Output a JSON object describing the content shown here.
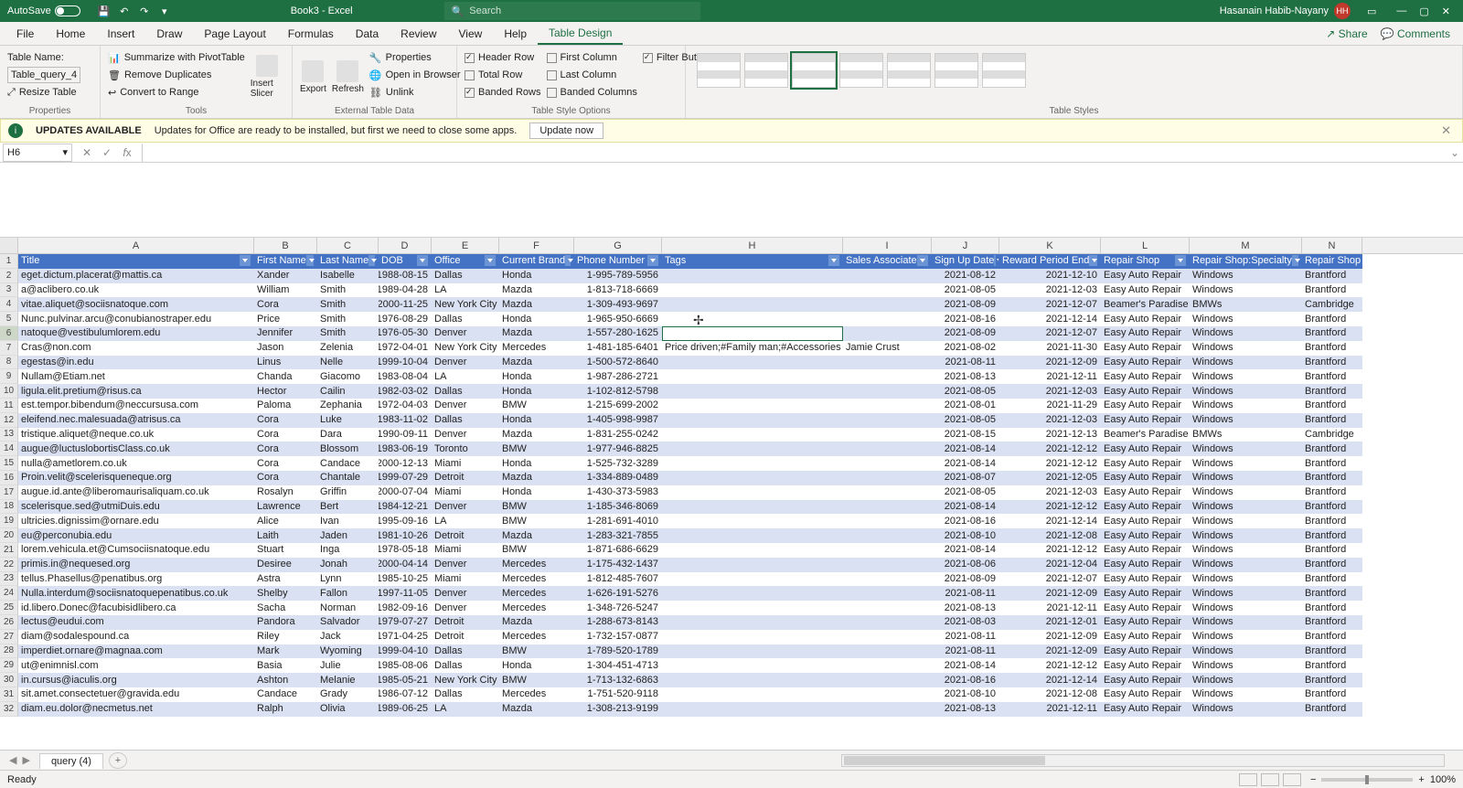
{
  "titlebar": {
    "autosave": "AutoSave",
    "autosave_state": "Off",
    "doc": "Book3 - Excel",
    "search_placeholder": "Search",
    "user": "Hasanain Habib-Nayany",
    "initials": "HH"
  },
  "tabs": [
    "File",
    "Home",
    "Insert",
    "Draw",
    "Page Layout",
    "Formulas",
    "Data",
    "Review",
    "View",
    "Help",
    "Table Design"
  ],
  "active_tab": "Table Design",
  "ribbon_right": {
    "share": "Share",
    "comments": "Comments"
  },
  "ribbon": {
    "properties": {
      "label": "Properties",
      "name_lbl": "Table Name:",
      "name_val": "Table_query_4",
      "resize": "Resize Table"
    },
    "tools": {
      "label": "Tools",
      "pivot": "Summarize with PivotTable",
      "dup": "Remove Duplicates",
      "range": "Convert to Range",
      "slicer": "Insert\nSlicer"
    },
    "external": {
      "label": "External Table Data",
      "export": "Export",
      "refresh": "Refresh",
      "props": "Properties",
      "browser": "Open in Browser",
      "unlink": "Unlink"
    },
    "styleopts": {
      "label": "Table Style Options",
      "header_row": "Header Row",
      "total_row": "Total Row",
      "banded_rows": "Banded Rows",
      "first_col": "First Column",
      "last_col": "Last Column",
      "banded_cols": "Banded Columns",
      "filter": "Filter Button"
    },
    "styles": {
      "label": "Table Styles"
    }
  },
  "msgbar": {
    "title": "UPDATES AVAILABLE",
    "text": "Updates for Office are ready to be installed, but first we need to close some apps.",
    "btn": "Update now"
  },
  "namebox": "H6",
  "columns": [
    {
      "letter": "A",
      "cls": "col-A",
      "field": "Title"
    },
    {
      "letter": "B",
      "cls": "col-B",
      "field": "First Name"
    },
    {
      "letter": "C",
      "cls": "col-C",
      "field": "Last Name"
    },
    {
      "letter": "D",
      "cls": "col-D",
      "field": "DOB"
    },
    {
      "letter": "E",
      "cls": "col-E",
      "field": "Office"
    },
    {
      "letter": "F",
      "cls": "col-F",
      "field": "Current Brand"
    },
    {
      "letter": "G",
      "cls": "col-G",
      "field": "Phone Number"
    },
    {
      "letter": "H",
      "cls": "col-H",
      "field": "Tags"
    },
    {
      "letter": "I",
      "cls": "col-I",
      "field": "Sales Associate"
    },
    {
      "letter": "J",
      "cls": "col-J",
      "field": "Sign Up Date"
    },
    {
      "letter": "K",
      "cls": "col-K",
      "field": "Reward Period End"
    },
    {
      "letter": "L",
      "cls": "col-L",
      "field": "Repair Shop"
    },
    {
      "letter": "M",
      "cls": "col-M",
      "field": "Repair Shop:Specialty"
    },
    {
      "letter": "N",
      "cls": "col-N",
      "field": "Repair Shop"
    }
  ],
  "right_align": [
    "DOB",
    "Phone Number",
    "Sign Up Date",
    "Reward Period End"
  ],
  "selected_row": 6,
  "rows": [
    {
      "n": 2,
      "d": [
        "eget.dictum.placerat@mattis.ca",
        "Xander",
        "Isabelle",
        "1988-08-15",
        "Dallas",
        "Honda",
        "1-995-789-5956",
        "",
        "",
        "2021-08-12",
        "2021-12-10",
        "Easy Auto Repair",
        "Windows",
        "Brantford"
      ]
    },
    {
      "n": 3,
      "d": [
        "a@aclibero.co.uk",
        "William",
        "Smith",
        "1989-04-28",
        "LA",
        "Mazda",
        "1-813-718-6669",
        "",
        "",
        "2021-08-05",
        "2021-12-03",
        "Easy Auto Repair",
        "Windows",
        "Brantford"
      ]
    },
    {
      "n": 4,
      "d": [
        "vitae.aliquet@sociisnatoque.com",
        "Cora",
        "Smith",
        "2000-11-25",
        "New York City",
        "Mazda",
        "1-309-493-9697",
        "",
        "",
        "2021-08-09",
        "2021-12-07",
        "Beamer's Paradise",
        "BMWs",
        "Cambridge"
      ]
    },
    {
      "n": 5,
      "d": [
        "Nunc.pulvinar.arcu@conubianostraper.edu",
        "Price",
        "Smith",
        "1976-08-29",
        "Dallas",
        "Honda",
        "1-965-950-6669",
        "",
        "",
        "2021-08-16",
        "2021-12-14",
        "Easy Auto Repair",
        "Windows",
        "Brantford"
      ]
    },
    {
      "n": 6,
      "d": [
        "natoque@vestibulumlorem.edu",
        "Jennifer",
        "Smith",
        "1976-05-30",
        "Denver",
        "Mazda",
        "1-557-280-1625",
        "",
        "",
        "2021-08-09",
        "2021-12-07",
        "Easy Auto Repair",
        "Windows",
        "Brantford"
      ]
    },
    {
      "n": 7,
      "d": [
        "Cras@non.com",
        "Jason",
        "Zelenia",
        "1972-04-01",
        "New York City",
        "Mercedes",
        "1-481-185-6401",
        "Price driven;#Family man;#Accessories",
        "Jamie Crust",
        "2021-08-02",
        "2021-11-30",
        "Easy Auto Repair",
        "Windows",
        "Brantford"
      ]
    },
    {
      "n": 8,
      "d": [
        "egestas@in.edu",
        "Linus",
        "Nelle",
        "1999-10-04",
        "Denver",
        "Mazda",
        "1-500-572-8640",
        "",
        "",
        "2021-08-11",
        "2021-12-09",
        "Easy Auto Repair",
        "Windows",
        "Brantford"
      ]
    },
    {
      "n": 9,
      "d": [
        "Nullam@Etiam.net",
        "Chanda",
        "Giacomo",
        "1983-08-04",
        "LA",
        "Honda",
        "1-987-286-2721",
        "",
        "",
        "2021-08-13",
        "2021-12-11",
        "Easy Auto Repair",
        "Windows",
        "Brantford"
      ]
    },
    {
      "n": 10,
      "d": [
        "ligula.elit.pretium@risus.ca",
        "Hector",
        "Cailin",
        "1982-03-02",
        "Dallas",
        "Honda",
        "1-102-812-5798",
        "",
        "",
        "2021-08-05",
        "2021-12-03",
        "Easy Auto Repair",
        "Windows",
        "Brantford"
      ]
    },
    {
      "n": 11,
      "d": [
        "est.tempor.bibendum@neccursusa.com",
        "Paloma",
        "Zephania",
        "1972-04-03",
        "Denver",
        "BMW",
        "1-215-699-2002",
        "",
        "",
        "2021-08-01",
        "2021-11-29",
        "Easy Auto Repair",
        "Windows",
        "Brantford"
      ]
    },
    {
      "n": 12,
      "d": [
        "eleifend.nec.malesuada@atrisus.ca",
        "Cora",
        "Luke",
        "1983-11-02",
        "Dallas",
        "Honda",
        "1-405-998-9987",
        "",
        "",
        "2021-08-05",
        "2021-12-03",
        "Easy Auto Repair",
        "Windows",
        "Brantford"
      ]
    },
    {
      "n": 13,
      "d": [
        "tristique.aliquet@neque.co.uk",
        "Cora",
        "Dara",
        "1990-09-11",
        "Denver",
        "Mazda",
        "1-831-255-0242",
        "",
        "",
        "2021-08-15",
        "2021-12-13",
        "Beamer's Paradise",
        "BMWs",
        "Cambridge"
      ]
    },
    {
      "n": 14,
      "d": [
        "augue@luctuslobortisClass.co.uk",
        "Cora",
        "Blossom",
        "1983-06-19",
        "Toronto",
        "BMW",
        "1-977-946-8825",
        "",
        "",
        "2021-08-14",
        "2021-12-12",
        "Easy Auto Repair",
        "Windows",
        "Brantford"
      ]
    },
    {
      "n": 15,
      "d": [
        "nulla@ametlorem.co.uk",
        "Cora",
        "Candace",
        "2000-12-13",
        "Miami",
        "Honda",
        "1-525-732-3289",
        "",
        "",
        "2021-08-14",
        "2021-12-12",
        "Easy Auto Repair",
        "Windows",
        "Brantford"
      ]
    },
    {
      "n": 16,
      "d": [
        "Proin.velit@scelerisqueneque.org",
        "Cora",
        "Chantale",
        "1999-07-29",
        "Detroit",
        "Mazda",
        "1-334-889-0489",
        "",
        "",
        "2021-08-07",
        "2021-12-05",
        "Easy Auto Repair",
        "Windows",
        "Brantford"
      ]
    },
    {
      "n": 17,
      "d": [
        "augue.id.ante@liberomaurisaliquam.co.uk",
        "Rosalyn",
        "Griffin",
        "2000-07-04",
        "Miami",
        "Honda",
        "1-430-373-5983",
        "",
        "",
        "2021-08-05",
        "2021-12-03",
        "Easy Auto Repair",
        "Windows",
        "Brantford"
      ]
    },
    {
      "n": 18,
      "d": [
        "scelerisque.sed@utmiDuis.edu",
        "Lawrence",
        "Bert",
        "1984-12-21",
        "Denver",
        "BMW",
        "1-185-346-8069",
        "",
        "",
        "2021-08-14",
        "2021-12-12",
        "Easy Auto Repair",
        "Windows",
        "Brantford"
      ]
    },
    {
      "n": 19,
      "d": [
        "ultricies.dignissim@ornare.edu",
        "Alice",
        "Ivan",
        "1995-09-16",
        "LA",
        "BMW",
        "1-281-691-4010",
        "",
        "",
        "2021-08-16",
        "2021-12-14",
        "Easy Auto Repair",
        "Windows",
        "Brantford"
      ]
    },
    {
      "n": 20,
      "d": [
        "eu@perconubia.edu",
        "Laith",
        "Jaden",
        "1981-10-26",
        "Detroit",
        "Mazda",
        "1-283-321-7855",
        "",
        "",
        "2021-08-10",
        "2021-12-08",
        "Easy Auto Repair",
        "Windows",
        "Brantford"
      ]
    },
    {
      "n": 21,
      "d": [
        "lorem.vehicula.et@Cumsociisnatoque.edu",
        "Stuart",
        "Inga",
        "1978-05-18",
        "Miami",
        "BMW",
        "1-871-686-6629",
        "",
        "",
        "2021-08-14",
        "2021-12-12",
        "Easy Auto Repair",
        "Windows",
        "Brantford"
      ]
    },
    {
      "n": 22,
      "d": [
        "primis.in@nequesed.org",
        "Desiree",
        "Jonah",
        "2000-04-14",
        "Denver",
        "Mercedes",
        "1-175-432-1437",
        "",
        "",
        "2021-08-06",
        "2021-12-04",
        "Easy Auto Repair",
        "Windows",
        "Brantford"
      ]
    },
    {
      "n": 23,
      "d": [
        "tellus.Phasellus@penatibus.org",
        "Astra",
        "Lynn",
        "1985-10-25",
        "Miami",
        "Mercedes",
        "1-812-485-7607",
        "",
        "",
        "2021-08-09",
        "2021-12-07",
        "Easy Auto Repair",
        "Windows",
        "Brantford"
      ]
    },
    {
      "n": 24,
      "d": [
        "Nulla.interdum@sociisnatoquepenatibus.co.uk",
        "Shelby",
        "Fallon",
        "1997-11-05",
        "Denver",
        "Mercedes",
        "1-626-191-5276",
        "",
        "",
        "2021-08-11",
        "2021-12-09",
        "Easy Auto Repair",
        "Windows",
        "Brantford"
      ]
    },
    {
      "n": 25,
      "d": [
        "id.libero.Donec@facubisidlibero.ca",
        "Sacha",
        "Norman",
        "1982-09-16",
        "Denver",
        "Mercedes",
        "1-348-726-5247",
        "",
        "",
        "2021-08-13",
        "2021-12-11",
        "Easy Auto Repair",
        "Windows",
        "Brantford"
      ]
    },
    {
      "n": 26,
      "d": [
        "lectus@eudui.com",
        "Pandora",
        "Salvador",
        "1979-07-27",
        "Detroit",
        "Mazda",
        "1-288-673-8143",
        "",
        "",
        "2021-08-03",
        "2021-12-01",
        "Easy Auto Repair",
        "Windows",
        "Brantford"
      ]
    },
    {
      "n": 27,
      "d": [
        "diam@sodalespound.ca",
        "Riley",
        "Jack",
        "1971-04-25",
        "Detroit",
        "Mercedes",
        "1-732-157-0877",
        "",
        "",
        "2021-08-11",
        "2021-12-09",
        "Easy Auto Repair",
        "Windows",
        "Brantford"
      ]
    },
    {
      "n": 28,
      "d": [
        "imperdiet.ornare@magnaa.com",
        "Mark",
        "Wyoming",
        "1999-04-10",
        "Dallas",
        "BMW",
        "1-789-520-1789",
        "",
        "",
        "2021-08-11",
        "2021-12-09",
        "Easy Auto Repair",
        "Windows",
        "Brantford"
      ]
    },
    {
      "n": 29,
      "d": [
        "ut@enimnisl.com",
        "Basia",
        "Julie",
        "1985-08-06",
        "Dallas",
        "Honda",
        "1-304-451-4713",
        "",
        "",
        "2021-08-14",
        "2021-12-12",
        "Easy Auto Repair",
        "Windows",
        "Brantford"
      ]
    },
    {
      "n": 30,
      "d": [
        "in.cursus@iaculis.org",
        "Ashton",
        "Melanie",
        "1985-05-21",
        "New York City",
        "BMW",
        "1-713-132-6863",
        "",
        "",
        "2021-08-16",
        "2021-12-14",
        "Easy Auto Repair",
        "Windows",
        "Brantford"
      ]
    },
    {
      "n": 31,
      "d": [
        "sit.amet.consectetuer@gravida.edu",
        "Candace",
        "Grady",
        "1986-07-12",
        "Dallas",
        "Mercedes",
        "1-751-520-9118",
        "",
        "",
        "2021-08-10",
        "2021-12-08",
        "Easy Auto Repair",
        "Windows",
        "Brantford"
      ]
    },
    {
      "n": 32,
      "d": [
        "diam.eu.dolor@necmetus.net",
        "Ralph",
        "Olivia",
        "1989-06-25",
        "LA",
        "Mazda",
        "1-308-213-9199",
        "",
        "",
        "2021-08-13",
        "2021-12-11",
        "Easy Auto Repair",
        "Windows",
        "Brantford"
      ]
    }
  ],
  "sheet": {
    "active": "query (4)"
  },
  "status": {
    "ready": "Ready",
    "zoom": "100%"
  }
}
